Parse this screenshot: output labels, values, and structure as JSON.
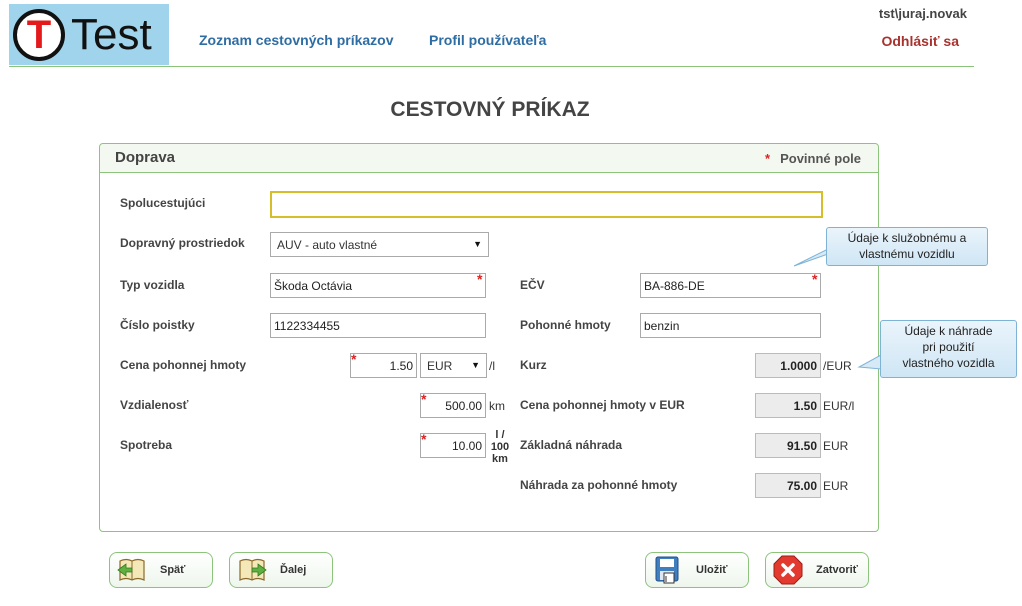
{
  "header": {
    "logo_letter": "T",
    "logo_text": "Test",
    "nav": [
      {
        "label": "Zoznam cestovných príkazov"
      },
      {
        "label": "Profil používateľa"
      }
    ],
    "user": "tst\\juraj.novak",
    "logout": "Odhlásiť sa"
  },
  "page_title": "CESTOVNÝ PRÍKAZ",
  "panel": {
    "title": "Doprava",
    "required_star": "*",
    "required_note": "Povinné pole"
  },
  "form": {
    "spolucestujuci": {
      "label": "Spolucestujúci",
      "value": ""
    },
    "prostriedok": {
      "label": "Dopravný prostriedok",
      "value": "AUV - auto vlastné"
    },
    "typ_vozidla": {
      "label": "Typ vozidla",
      "value": "Škoda Octávia"
    },
    "ecv": {
      "label": "EČV",
      "value": "BA-886-DE"
    },
    "cislo_poistky": {
      "label": "Číslo poistky",
      "value": "1122334455"
    },
    "pohonne_hmoty": {
      "label": "Pohonné hmoty",
      "value": "benzin"
    },
    "cena_ph": {
      "label": "Cena pohonnej hmoty",
      "value": "1.50",
      "currency": "EUR",
      "unit": "/l"
    },
    "kurz": {
      "label": "Kurz",
      "value": "1.0000",
      "unit": "/EUR"
    },
    "vzdialenost": {
      "label": "Vzdialenosť",
      "value": "500.00",
      "unit": "km"
    },
    "cena_ph_eur": {
      "label": "Cena pohonnej hmoty v EUR",
      "value": "1.50",
      "unit": "EUR/l"
    },
    "spotreba": {
      "label": "Spotreba",
      "value": "10.00",
      "unit_line1": "l /",
      "unit_line2": "100",
      "unit_line3": "km"
    },
    "zakladna_nahrada": {
      "label": "Základná náhrada",
      "value": "91.50",
      "unit": "EUR"
    },
    "nahrada_ph": {
      "label": "Náhrada za pohonné hmoty",
      "value": "75.00",
      "unit": "EUR"
    }
  },
  "callouts": {
    "vozidlo": {
      "line1": "Údaje k služobnému a",
      "line2": "vlastnému vozidlu"
    },
    "nahrada": {
      "line1": "Údaje k náhrade",
      "line2": "pri použití",
      "line3": "vlastného vozidla"
    }
  },
  "buttons": {
    "back": "Späť",
    "next": "Ďalej",
    "save": "Uložiť",
    "close": "Zatvoriť"
  },
  "colors": {
    "accent_green": "#8cc47c",
    "link_blue": "#2e6da4",
    "logout_red": "#a8322d",
    "required_red": "#dd2222"
  }
}
